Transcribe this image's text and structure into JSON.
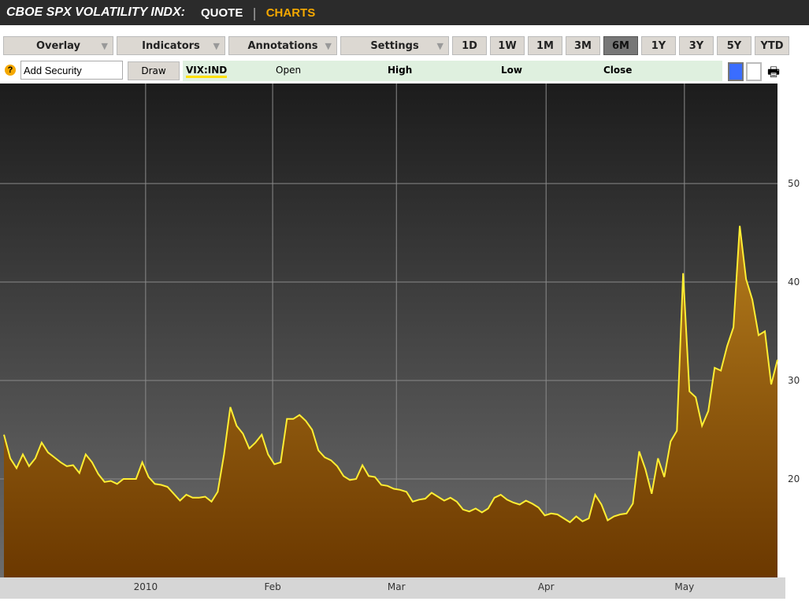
{
  "header": {
    "title": "CBOE SPX VOLATILITY INDX:",
    "quote": "QUOTE",
    "separator": "|",
    "charts": "CHARTS"
  },
  "toolbar": {
    "menus": [
      "Overlay",
      "Indicators",
      "Annotations",
      "Settings"
    ],
    "ranges": [
      "1D",
      "1W",
      "1M",
      "3M",
      "6M",
      "1Y",
      "3Y",
      "5Y",
      "YTD"
    ],
    "selected_range": "6M"
  },
  "row2": {
    "help": "?",
    "add_security_value": "Add Security",
    "draw": "Draw",
    "symbol": "VIX:IND",
    "open": "Open",
    "high": "High",
    "low": "Low",
    "close": "Close"
  },
  "colors": {
    "line": "#ffee33",
    "fill_top": "#b47c1c",
    "fill_bottom": "#6b3800",
    "swatch_selected": "#3a6dff"
  },
  "chart_data": {
    "type": "area",
    "series_name": "VIX:IND",
    "ylim": [
      10,
      60
    ],
    "yticks": [
      20,
      30,
      40,
      50
    ],
    "xticks": [
      {
        "label": "2010",
        "pos": 0.18
      },
      {
        "label": "Feb",
        "pos": 0.337
      },
      {
        "label": "Mar",
        "pos": 0.49
      },
      {
        "label": "Apr",
        "pos": 0.675
      },
      {
        "label": "May",
        "pos": 0.846
      }
    ],
    "values": [
      24.5,
      22.1,
      21.1,
      22.5,
      21.3,
      22.1,
      23.7,
      22.7,
      22.2,
      21.7,
      21.3,
      21.4,
      20.6,
      22.5,
      21.7,
      20.5,
      19.7,
      19.8,
      19.5,
      20.0,
      20.0,
      20.0,
      21.7,
      20.2,
      19.5,
      19.4,
      19.2,
      18.5,
      17.8,
      18.4,
      18.1,
      18.1,
      18.2,
      17.7,
      18.7,
      22.5,
      27.3,
      25.4,
      24.6,
      23.1,
      23.7,
      24.5,
      22.5,
      21.5,
      21.7,
      26.1,
      26.1,
      26.5,
      25.9,
      25.0,
      22.9,
      22.2,
      21.9,
      21.3,
      20.3,
      19.9,
      20.0,
      21.4,
      20.3,
      20.2,
      19.4,
      19.3,
      19.0,
      18.9,
      18.7,
      17.7,
      17.9,
      18.0,
      18.6,
      18.2,
      17.8,
      18.1,
      17.7,
      16.9,
      16.7,
      17.0,
      16.6,
      17.0,
      18.1,
      18.4,
      17.9,
      17.6,
      17.4,
      17.8,
      17.5,
      17.1,
      16.3,
      16.5,
      16.4,
      16.0,
      15.6,
      16.2,
      15.7,
      16.0,
      18.4,
      17.4,
      15.8,
      16.2,
      16.4,
      16.5,
      17.5,
      22.8,
      21.0,
      18.5,
      22.1,
      20.2,
      23.8,
      24.9,
      40.9,
      28.9,
      28.3,
      25.4,
      26.9,
      31.3,
      31.0,
      33.5,
      35.4,
      45.7,
      40.3,
      38.2,
      34.6,
      35.0,
      29.6,
      32.1
    ]
  }
}
